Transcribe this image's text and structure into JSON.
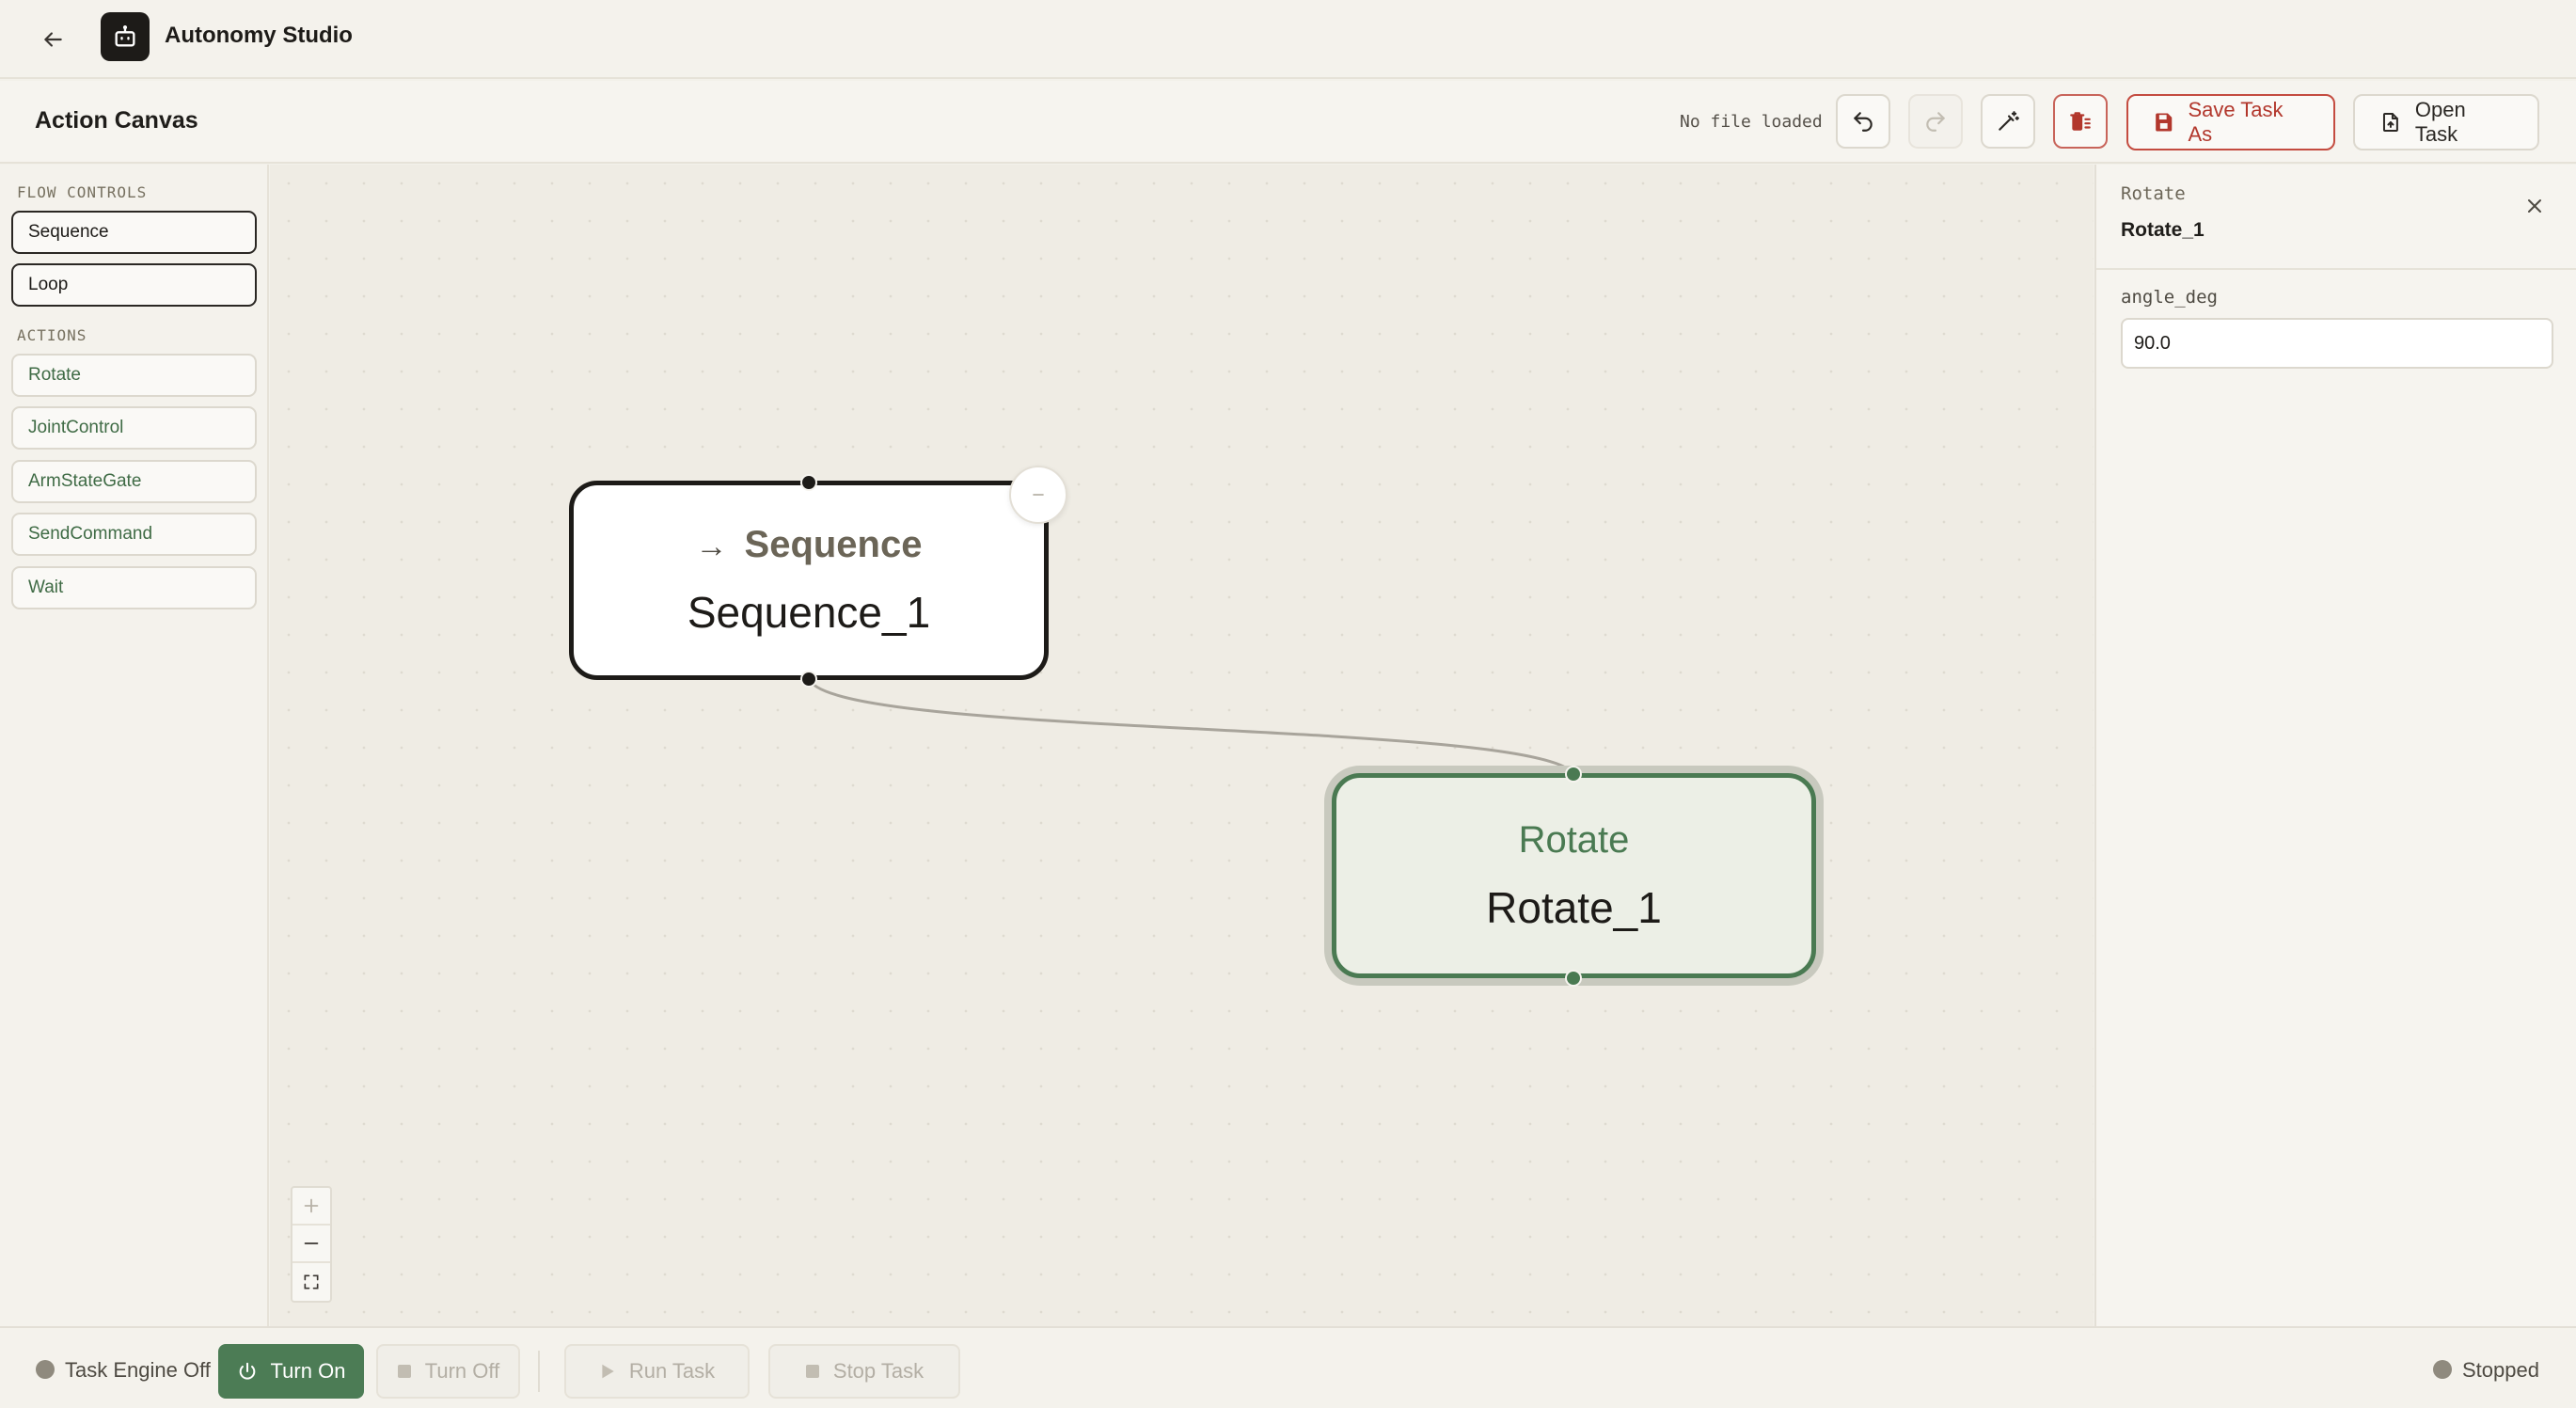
{
  "app": {
    "title": "Autonomy Studio",
    "back_icon": "arrow-left-icon",
    "logo_icon": "robot-icon"
  },
  "toolbar": {
    "canvas_title": "Action Canvas",
    "file_status": "No file loaded",
    "save_label": "Save Task As",
    "open_label": "Open Task"
  },
  "palette": {
    "flow_heading": "FLOW CONTROLS",
    "flow_items": [
      {
        "label": "Sequence"
      },
      {
        "label": "Loop"
      }
    ],
    "actions_heading": "ACTIONS",
    "action_items": [
      {
        "label": "Rotate"
      },
      {
        "label": "JointControl"
      },
      {
        "label": "ArmStateGate"
      },
      {
        "label": "SendCommand"
      },
      {
        "label": "Wait"
      }
    ]
  },
  "canvas": {
    "nodes": [
      {
        "type": "Sequence",
        "name": "Sequence_1",
        "symbol": "→"
      },
      {
        "type": "Rotate",
        "name": "Rotate_1"
      }
    ]
  },
  "inspector": {
    "node_type": "Rotate",
    "node_name": "Rotate_1",
    "field_label": "angle_deg",
    "field_value": "90.0"
  },
  "statusbar": {
    "engine_status": "Task Engine Off",
    "turn_on": "Turn On",
    "turn_off": "Turn Off",
    "run_task": "Run Task",
    "stop_task": "Stop Task",
    "run_status": "Stopped"
  },
  "colors": {
    "accent_green": "#4c7c55",
    "danger_red": "#c44c40",
    "status_grey": "#8f8a7e"
  }
}
